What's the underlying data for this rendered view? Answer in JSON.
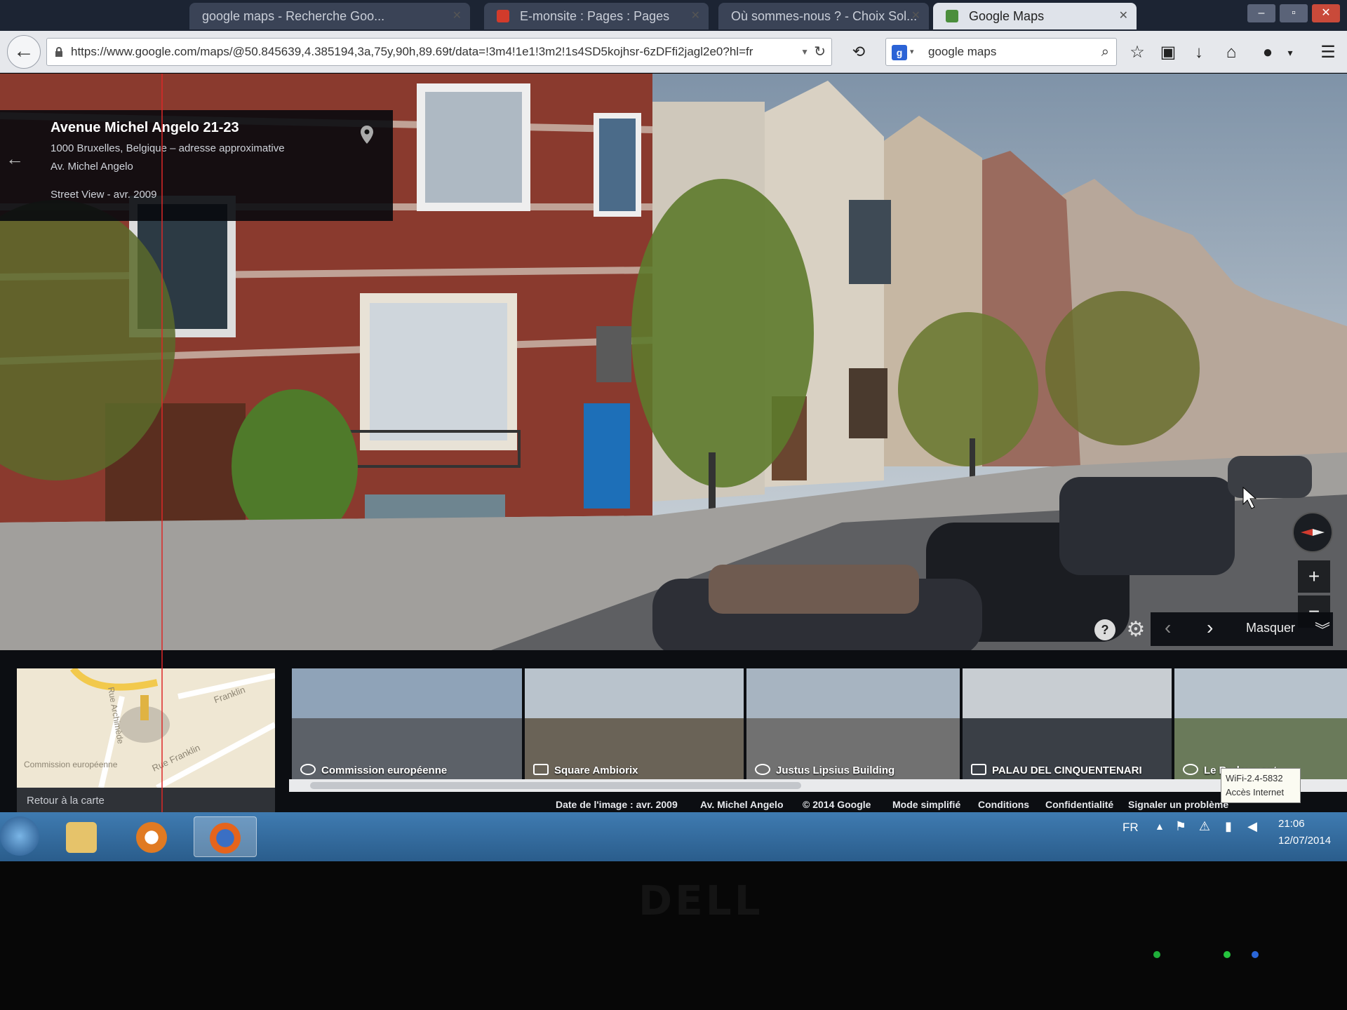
{
  "tabs": [
    {
      "label": "google maps - Recherche Goo...",
      "active": false
    },
    {
      "label": "E-monsite : Pages : Pages",
      "active": false
    },
    {
      "label": "Où sommes-nous ? - Choix Sol...",
      "active": false
    },
    {
      "label": "Google Maps",
      "active": true
    }
  ],
  "navbar": {
    "url": "https://www.google.com/maps/@50.845639,4.385194,3a,75y,90h,89.69t/data=!3m4!1e1!3m2!1s4SD5kojhsr-6zDFfi2jagl2e0?hl=fr",
    "search_value": "google maps"
  },
  "streetview": {
    "title": "Avenue Michel Angelo 21-23",
    "address": "1000 Bruxelles, Belgique – adresse approximative",
    "street": "Av. Michel Angelo",
    "capture": "Street View - avr. 2009",
    "hide_label": "Masquer"
  },
  "filmstrip": {
    "back_to_map": "Retour à la carte",
    "minimap_labels": [
      "Rue Franklin",
      "Commission européenne",
      "Rue Archimède",
      "Franklin"
    ],
    "items": [
      {
        "label": "Commission européenne",
        "kind": "streetview",
        "color1": "#8fa3b8",
        "color2": "#5c6168"
      },
      {
        "label": "Square Ambiorix",
        "kind": "photo",
        "color1": "#b9c3cc",
        "color2": "#6a6357"
      },
      {
        "label": "Justus Lipsius Building",
        "kind": "streetview",
        "color1": "#a7b4c1",
        "color2": "#717171"
      },
      {
        "label": "PALAU DEL CINQUENTENARI",
        "kind": "photo",
        "color1": "#c8cdd2",
        "color2": "#3a3f46"
      },
      {
        "label": "Le Berlaymont",
        "kind": "streetview",
        "color1": "#b7c2cc",
        "color2": "#6a7a5a"
      }
    ],
    "footer": [
      "Date de l'image : avr. 2009",
      "Av. Michel Angelo",
      "© 2014 Google",
      "Mode simplifié",
      "Conditions",
      "Confidentialité",
      "Signaler un problème"
    ],
    "wifi_tooltip": [
      "WiFi-2.4-5832",
      "Accès Internet"
    ]
  },
  "taskbar": {
    "language": "FR",
    "time": "21:06",
    "date": "12/07/2014"
  },
  "bezel": {
    "brand": "DELL"
  },
  "colors": {
    "chrome_dark": "#1c2433",
    "taskbar": "#2a5d8c",
    "brick": "#8a3a2e",
    "door_blue": "#1d6fb8"
  }
}
